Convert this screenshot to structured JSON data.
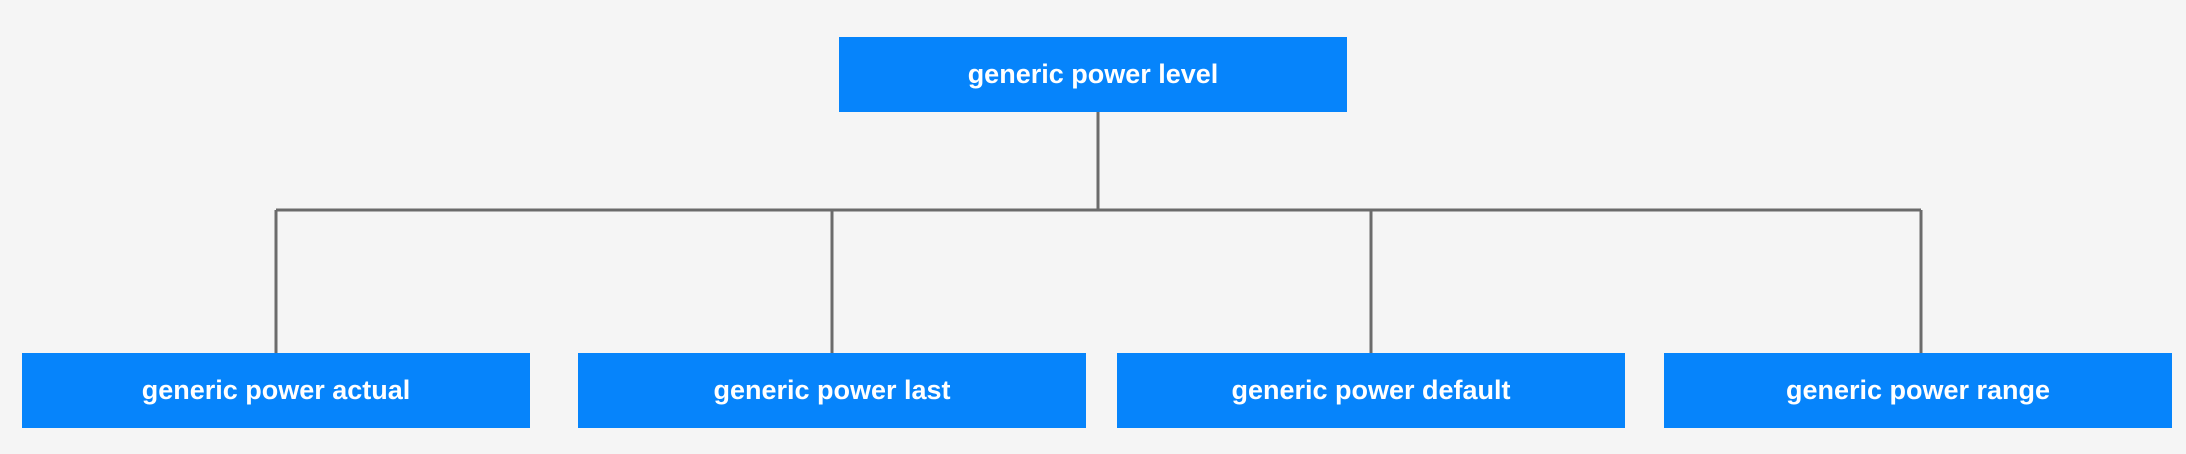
{
  "diagram": {
    "type": "tree",
    "root": {
      "label": "generic power level"
    },
    "children": [
      {
        "label": "generic power actual"
      },
      {
        "label": "generic power last"
      },
      {
        "label": "generic power default"
      },
      {
        "label": "generic power range"
      }
    ]
  },
  "colors": {
    "background": "#f5f5f5",
    "node_fill": "#0684fb",
    "node_text": "#ffffff",
    "connector": "#6b6b6b"
  }
}
